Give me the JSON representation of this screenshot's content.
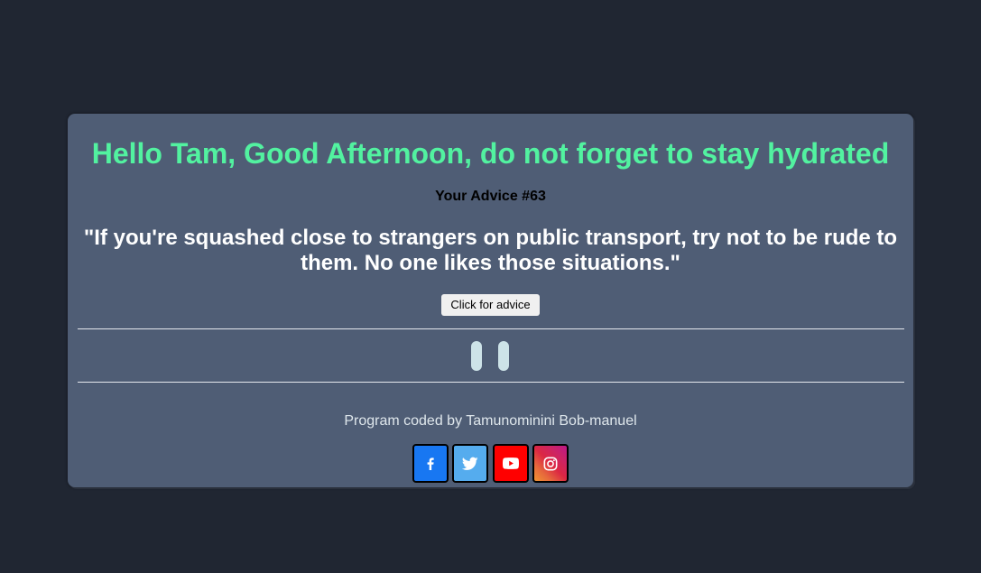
{
  "greeting": "Hello Tam, Good Afternoon, do not forget to stay hydrated",
  "advice": {
    "heading": "Your Advice #63",
    "text": "\"If you're squashed close to strangers on public transport, try not to be rude to them. No one likes those situations.\""
  },
  "button": {
    "label": "Click for advice"
  },
  "divider_icon": "pause-icon",
  "footer": {
    "credit": "Program coded by Tamunominini Bob-manuel",
    "socials": [
      {
        "name": "facebook-icon",
        "color": "#1877f2"
      },
      {
        "name": "twitter-icon",
        "color": "#55acee"
      },
      {
        "name": "youtube-icon",
        "color": "#ff0000"
      },
      {
        "name": "instagram-icon",
        "color": "#dc2743"
      }
    ]
  },
  "colors": {
    "background": "#202632",
    "card": "#4f5d75",
    "greeting": "#52f2a0"
  }
}
